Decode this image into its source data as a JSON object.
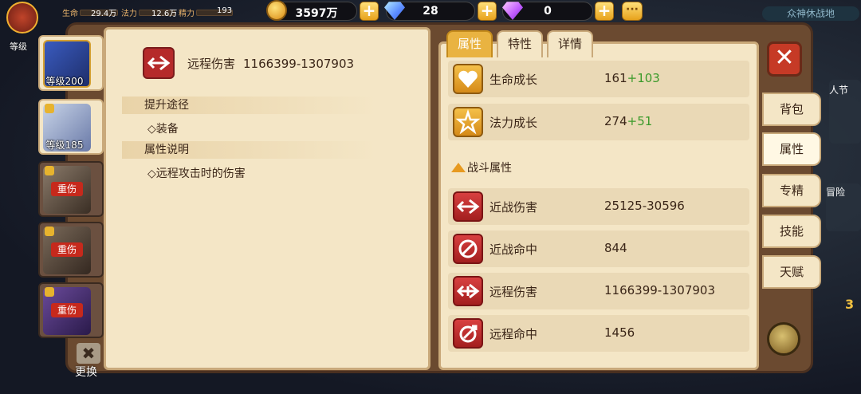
{
  "topbar": {
    "stats": [
      {
        "label": "生命",
        "value": "29.4万"
      },
      {
        "label": "法力",
        "value": "12.6万"
      },
      {
        "label": "精力",
        "value": "193"
      }
    ],
    "gold": "3597万",
    "diamond": "28",
    "purple_gem": "0",
    "region": "众神休战地",
    "avatar_label": "等级"
  },
  "characters": [
    {
      "level": "等级200",
      "active": true
    },
    {
      "level": "等级185",
      "active": false
    },
    {
      "status": "重伤"
    },
    {
      "status": "重伤"
    },
    {
      "status": "重伤"
    }
  ],
  "swap_label": "更换",
  "detail": {
    "title": "远程伤害",
    "value": "1166399-1307903",
    "sections": [
      {
        "title": "提升途径",
        "items": [
          "◇装备"
        ]
      },
      {
        "title": "属性说明",
        "items": [
          "◇远程攻击时的伤害"
        ]
      }
    ]
  },
  "tabs": [
    "属性",
    "特性",
    "详情"
  ],
  "growth": [
    {
      "name": "生命成长",
      "value": "161",
      "bonus": "+103",
      "icon": "heart-icon"
    },
    {
      "name": "法力成长",
      "value": "274",
      "bonus": "+51",
      "icon": "star-icon"
    }
  ],
  "battle_title": "战斗属性",
  "battle": [
    {
      "name": "近战伤害",
      "value": "25125-30596",
      "icon": "melee-damage-icon"
    },
    {
      "name": "近战命中",
      "value": "844",
      "icon": "melee-hit-icon"
    },
    {
      "name": "远程伤害",
      "value": "1166399-1307903",
      "icon": "ranged-damage-icon"
    },
    {
      "name": "远程命中",
      "value": "1456",
      "icon": "ranged-hit-icon"
    }
  ],
  "side_tabs": [
    "背包",
    "属性",
    "专精",
    "技能",
    "天赋"
  ],
  "close_label": "✕",
  "plus": "+",
  "more": "···",
  "bg_texts": {
    "adv": "冒险",
    "node": "人节",
    "three": "3"
  }
}
